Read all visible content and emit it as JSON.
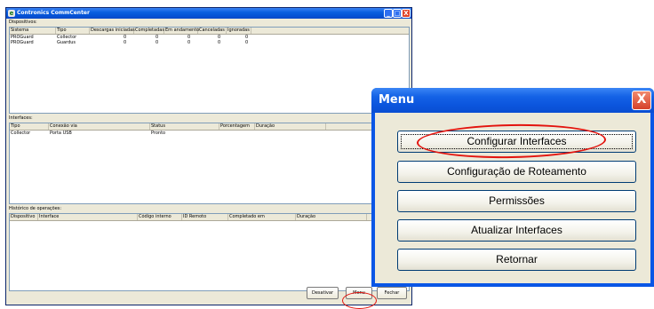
{
  "main_window": {
    "title": "Contronics CommCenter",
    "minimize": "_",
    "maximize": "□",
    "close": "X"
  },
  "dispositivos": {
    "label": "Dispositivos:",
    "columns": [
      "Sistema",
      "Tipo",
      "Descargas iniciadas",
      "Completadas",
      "Em andamento",
      "Canceladas",
      "Ignoradas"
    ],
    "rows": [
      [
        "PROGuard",
        "Collector",
        "0",
        "0",
        "0",
        "0",
        "0"
      ],
      [
        "PROGuard",
        "Guardus",
        "0",
        "0",
        "0",
        "0",
        "0"
      ]
    ]
  },
  "interfaces": {
    "label": "Interfaces:",
    "columns": [
      "Tipo",
      "Conexão via",
      "Status",
      "Porcentagem",
      "Duração"
    ],
    "rows": [
      [
        "Collector",
        "Porta USB",
        "Pronto",
        "",
        ""
      ]
    ]
  },
  "historico": {
    "label": "Histórico de operações:",
    "columns": [
      "Dispositivo",
      "Interface",
      "Código interno",
      "ID Remoto",
      "Completado em",
      "Duração"
    ],
    "rows": []
  },
  "bottom_buttons": {
    "desativar": "Desativar",
    "menu": "Menu",
    "fechar": "Fechar"
  },
  "menu_dialog": {
    "title": "Menu",
    "close": "X",
    "buttons": [
      "Configurar Interfaces",
      "Configuração de Roteamento",
      "Permissões",
      "Atualizar Interfaces",
      "Retornar"
    ]
  },
  "colors": {
    "titlebar": "#0553d6",
    "highlight": "#e3140e",
    "window_bg": "#ece9d8"
  }
}
